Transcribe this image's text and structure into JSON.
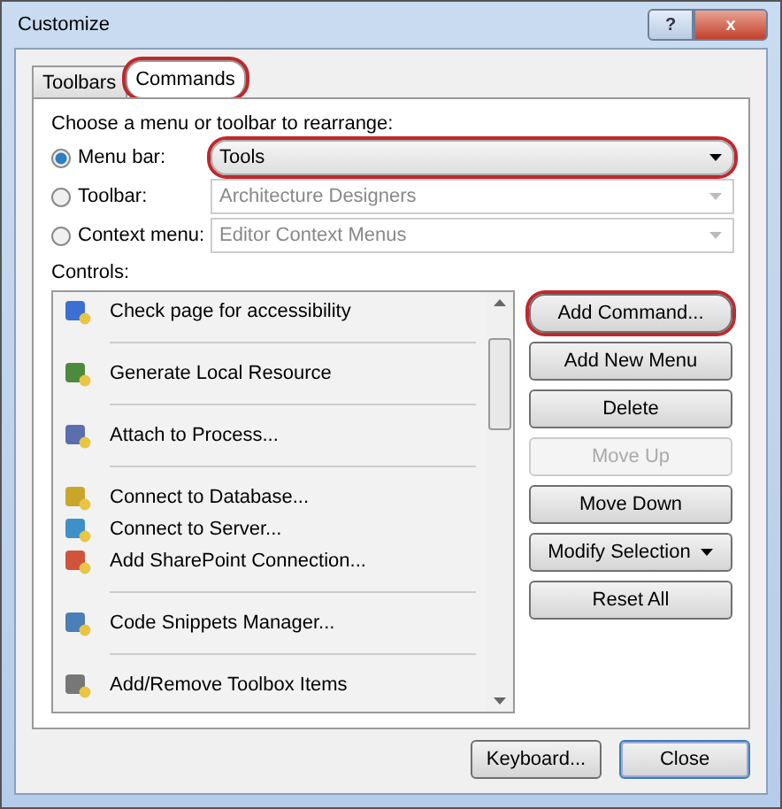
{
  "window": {
    "title": "Customize",
    "help_button": "?",
    "close_button": "x"
  },
  "tabs": [
    {
      "label": "Toolbars",
      "selected": false,
      "highlighted": false
    },
    {
      "label": "Commands",
      "selected": true,
      "highlighted": true
    }
  ],
  "choose_label": "Choose a menu or toolbar to rearrange:",
  "targets": [
    {
      "label": "Menu bar:",
      "selected": true,
      "value": "Tools",
      "disabled": false,
      "highlighted": true
    },
    {
      "label": "Toolbar:",
      "selected": false,
      "value": "Architecture Designers",
      "disabled": true,
      "highlighted": false
    },
    {
      "label": "Context menu:",
      "selected": false,
      "value": "Editor Context Menus",
      "disabled": true,
      "highlighted": false
    }
  ],
  "controls_label": "Controls:",
  "controls": [
    [
      {
        "label": "Check page for accessibility"
      }
    ],
    [
      {
        "label": "Generate Local Resource"
      }
    ],
    [
      {
        "label": "Attach to Process..."
      }
    ],
    [
      {
        "label": "Connect to Database..."
      },
      {
        "label": "Connect to Server..."
      },
      {
        "label": "Add SharePoint Connection..."
      }
    ],
    [
      {
        "label": "Code Snippets Manager..."
      }
    ],
    [
      {
        "label": "Add/Remove Toolbox Items"
      }
    ]
  ],
  "actions": [
    {
      "label": "Add Command...",
      "disabled": false,
      "highlighted": true,
      "dropdown": false
    },
    {
      "label": "Add New Menu",
      "disabled": false,
      "highlighted": false,
      "dropdown": false
    },
    {
      "label": "Delete",
      "disabled": false,
      "highlighted": false,
      "dropdown": false
    },
    {
      "label": "Move Up",
      "disabled": true,
      "highlighted": false,
      "dropdown": false
    },
    {
      "label": "Move Down",
      "disabled": false,
      "highlighted": false,
      "dropdown": false
    },
    {
      "label": "Modify Selection",
      "disabled": false,
      "highlighted": false,
      "dropdown": true
    },
    {
      "label": "Reset All",
      "disabled": false,
      "highlighted": false,
      "dropdown": false
    }
  ],
  "footer": [
    {
      "label": "Keyboard...",
      "default": false
    },
    {
      "label": "Close",
      "default": true
    }
  ]
}
